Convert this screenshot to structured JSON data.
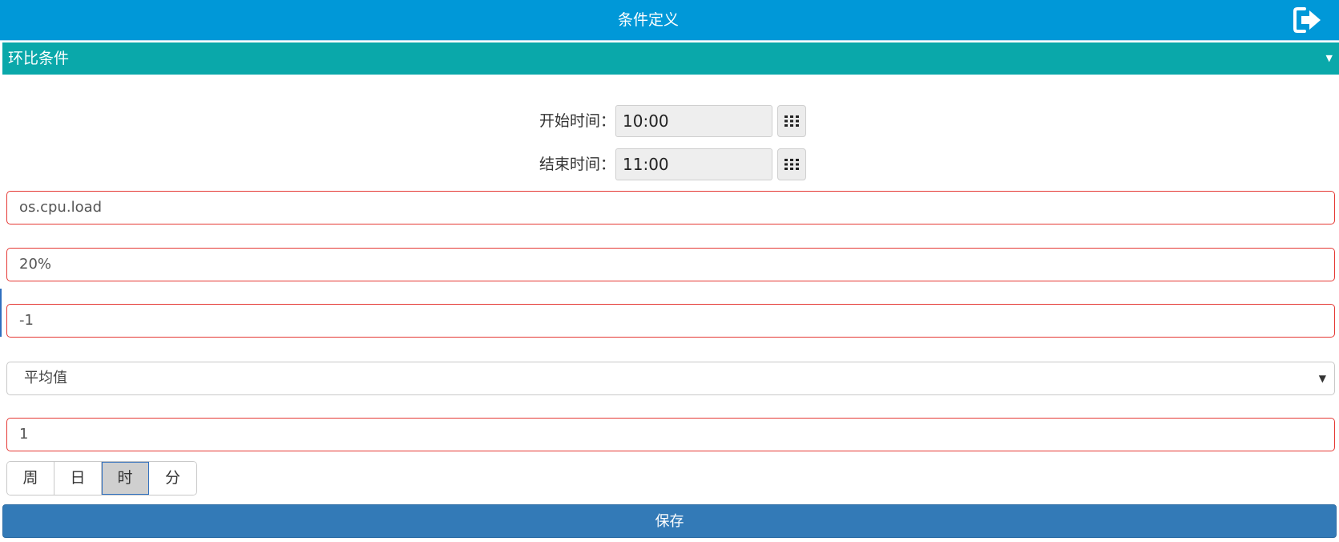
{
  "header": {
    "title": "条件定义",
    "exit_icon": "sign-out-icon"
  },
  "condition_type": {
    "selected": "环比条件"
  },
  "start_time": {
    "label": "开始时间：",
    "value": "10:00"
  },
  "end_time": {
    "label": "结束时间：",
    "value": "11:00"
  },
  "fields": {
    "metric": "os.cpu.load",
    "threshold": "20%",
    "offset": "-1",
    "aggregate": "平均值",
    "period_count": "1"
  },
  "units": {
    "items": [
      "周",
      "日",
      "时",
      "分"
    ],
    "selected": "时"
  },
  "save_label": "保存",
  "colors": {
    "header": "#0098d8",
    "condition_bar": "#0aa8aa",
    "save_button": "#337ab7",
    "error_border": "#e53935"
  }
}
